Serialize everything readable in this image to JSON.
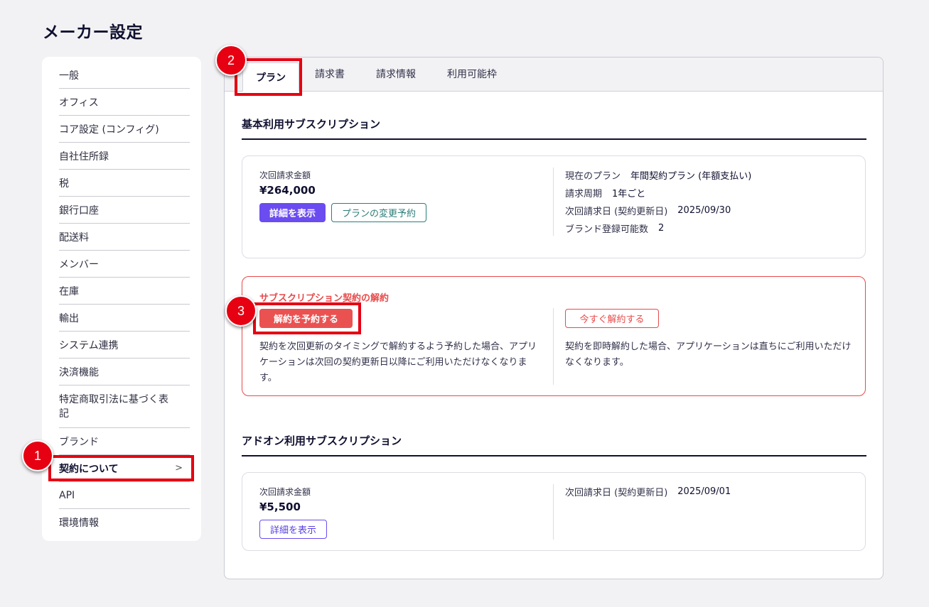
{
  "page_title": "メーカー設定",
  "sidebar": {
    "items": [
      {
        "label": "一般"
      },
      {
        "label": "オフィス"
      },
      {
        "label": "コア設定 (コンフィグ)"
      },
      {
        "label": "自社住所録"
      },
      {
        "label": "税"
      },
      {
        "label": "銀行口座"
      },
      {
        "label": "配送料"
      },
      {
        "label": "メンバー"
      },
      {
        "label": "在庫"
      },
      {
        "label": "輸出"
      },
      {
        "label": "システム連携"
      },
      {
        "label": "決済機能"
      },
      {
        "label": "特定商取引法に基づく表記"
      },
      {
        "label": "ブランド"
      },
      {
        "label": "契約について"
      },
      {
        "label": "API"
      },
      {
        "label": "環境情報"
      }
    ],
    "chevron": ">"
  },
  "tabs": [
    {
      "label": "プラン"
    },
    {
      "label": "請求書"
    },
    {
      "label": "請求情報"
    },
    {
      "label": "利用可能枠"
    }
  ],
  "basic": {
    "title": "基本利用サブスクリプション",
    "next_amount_label": "次回請求金額",
    "next_amount": "¥264,000",
    "details_button": "詳細を表示",
    "change_button": "プランの変更予約",
    "info": [
      {
        "k": "現在のプラン",
        "v": "年間契約プラン (年額支払い)"
      },
      {
        "k": "請求周期",
        "v": "1年ごと"
      },
      {
        "k": "次回請求日 (契約更新日)",
        "v": "2025/09/30"
      },
      {
        "k": "ブランド登録可能数",
        "v": "2"
      }
    ]
  },
  "cancel": {
    "title": "サブスクリプション契約の解約",
    "reserve_button": "解約を予約する",
    "reserve_desc": "契約を次回更新のタイミングで解約するよう予約した場合、アプリケーションは次回の契約更新日以降にご利用いただけなくなります。",
    "now_button": "今すぐ解約する",
    "now_desc": "契約を即時解約した場合、アプリケーションは直ちにご利用いただけなくなります。"
  },
  "addon": {
    "title": "アドオン利用サブスクリプション",
    "next_amount_label": "次回請求金額",
    "next_amount": "¥5,500",
    "details_button": "詳細を表示",
    "info": [
      {
        "k": "次回請求日 (契約更新日)",
        "v": "2025/09/01"
      }
    ]
  },
  "annotations": {
    "badge1": "1",
    "badge2": "2",
    "badge3": "3",
    "color": "#e60012"
  }
}
